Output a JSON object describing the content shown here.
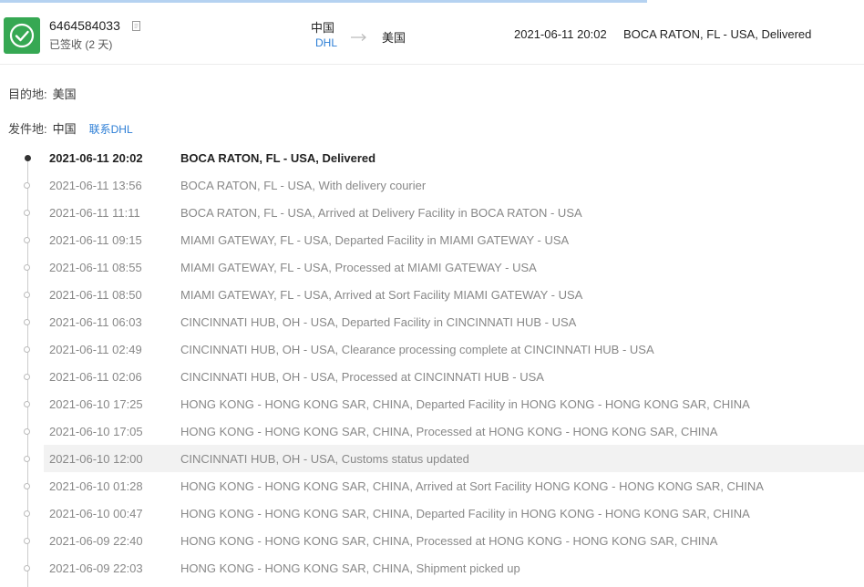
{
  "header": {
    "tracking_number": "6464584033",
    "status": "已签收 (2 天)",
    "origin_country": "中国",
    "carrier": "DHL",
    "destination_country": "美国",
    "latest_time": "2021-06-11 20:02",
    "latest_event": "BOCA RATON, FL - USA, Delivered"
  },
  "meta": {
    "destination_label": "目的地:",
    "destination_value": "美国",
    "origin_label": "发件地:",
    "origin_value": "中国",
    "contact_link": "联系DHL"
  },
  "events": [
    {
      "time": "2021-06-11 20:02",
      "desc": "BOCA RATON, FL - USA, Delivered"
    },
    {
      "time": "2021-06-11 13:56",
      "desc": "BOCA RATON, FL - USA, With delivery courier"
    },
    {
      "time": "2021-06-11 11:11",
      "desc": "BOCA RATON, FL - USA, Arrived at Delivery Facility in BOCA RATON - USA"
    },
    {
      "time": "2021-06-11 09:15",
      "desc": "MIAMI GATEWAY, FL - USA, Departed Facility in MIAMI GATEWAY - USA"
    },
    {
      "time": "2021-06-11 08:55",
      "desc": "MIAMI GATEWAY, FL - USA, Processed at MIAMI GATEWAY - USA"
    },
    {
      "time": "2021-06-11 08:50",
      "desc": "MIAMI GATEWAY, FL - USA, Arrived at Sort Facility MIAMI GATEWAY - USA"
    },
    {
      "time": "2021-06-11 06:03",
      "desc": "CINCINNATI HUB, OH - USA, Departed Facility in CINCINNATI HUB - USA"
    },
    {
      "time": "2021-06-11 02:49",
      "desc": "CINCINNATI HUB, OH - USA, Clearance processing complete at CINCINNATI HUB - USA"
    },
    {
      "time": "2021-06-11 02:06",
      "desc": "CINCINNATI HUB, OH - USA, Processed at CINCINNATI HUB - USA"
    },
    {
      "time": "2021-06-10 17:25",
      "desc": "HONG KONG - HONG KONG SAR, CHINA, Departed Facility in HONG KONG - HONG KONG SAR, CHINA"
    },
    {
      "time": "2021-06-10 17:05",
      "desc": "HONG KONG - HONG KONG SAR, CHINA, Processed at HONG KONG - HONG KONG SAR, CHINA"
    },
    {
      "time": "2021-06-10 12:00",
      "desc": "CINCINNATI HUB, OH - USA, Customs status updated"
    },
    {
      "time": "2021-06-10 01:28",
      "desc": "HONG KONG - HONG KONG SAR, CHINA, Arrived at Sort Facility HONG KONG - HONG KONG SAR, CHINA"
    },
    {
      "time": "2021-06-10 00:47",
      "desc": "HONG KONG - HONG KONG SAR, CHINA, Departed Facility in HONG KONG - HONG KONG SAR, CHINA"
    },
    {
      "time": "2021-06-09 22:40",
      "desc": "HONG KONG - HONG KONG SAR, CHINA, Processed at HONG KONG - HONG KONG SAR, CHINA"
    },
    {
      "time": "2021-06-09 22:03",
      "desc": "HONG KONG - HONG KONG SAR, CHINA, Shipment picked up"
    }
  ],
  "colors": {
    "accent": "#2c7ed6",
    "status_green": "#36a853",
    "highlight_row": "#f2f2f2"
  },
  "icons": {
    "status": "check-circle-icon",
    "copy": "copy-icon",
    "route": "arrow-right-icon"
  }
}
